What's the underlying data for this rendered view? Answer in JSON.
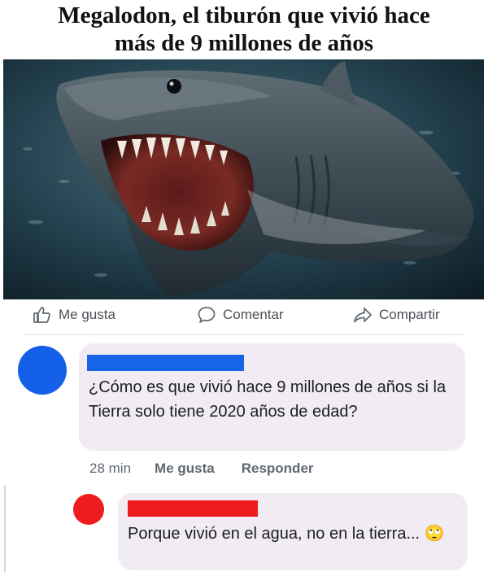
{
  "post": {
    "headline_line1": "Megalodon, el tiburón que vivió hace",
    "headline_line2": "más de 9 millones de años"
  },
  "actions": {
    "like": {
      "label": "Me gusta",
      "icon": "thumbs-up-icon"
    },
    "comment": {
      "label": "Comentar",
      "icon": "speech-bubble-icon"
    },
    "share": {
      "label": "Compartir",
      "icon": "share-arrow-icon"
    }
  },
  "comments": [
    {
      "avatar_color": "#1560e8",
      "text": "¿Cómo es que vivió hace 9 millones de años si la Tierra solo tiene 2020 años de edad?",
      "time": "28 min",
      "like_label": "Me gusta",
      "reply_label": "Responder"
    },
    {
      "avatar_color": "#ee1c1c",
      "text": "Porque vivió en el agua, no en la tierra...",
      "emoji": "🙄"
    }
  ],
  "colors": {
    "redaction_blue": "#1665e9",
    "redaction_red": "#ee1c1c",
    "bubble_bg": "#f1ecf4"
  }
}
